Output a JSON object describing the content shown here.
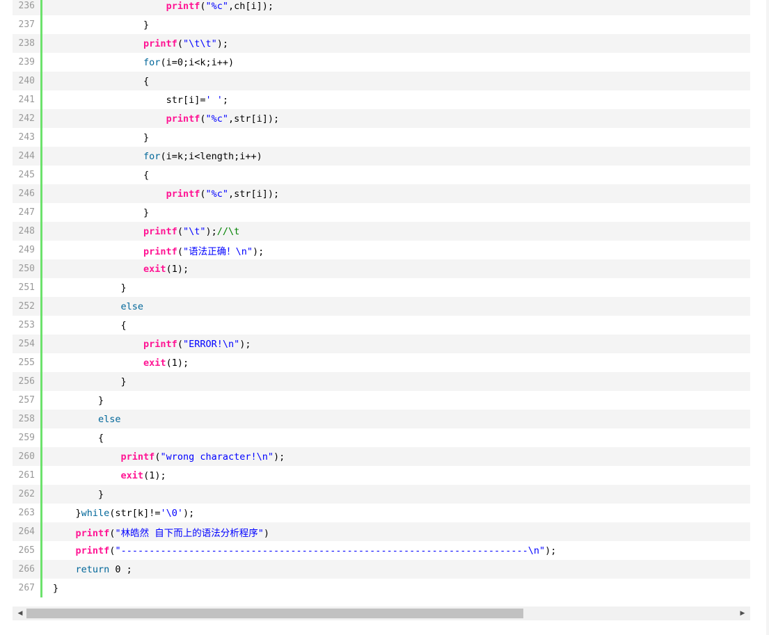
{
  "code": {
    "lines": [
      {
        "n": "236",
        "indent": 5,
        "tokens": [
          {
            "c": "fn",
            "t": "printf"
          },
          {
            "c": "",
            "t": "("
          },
          {
            "c": "str",
            "t": "\"%c\""
          },
          {
            "c": "",
            "t": ",ch[i]);"
          }
        ]
      },
      {
        "n": "237",
        "indent": 4,
        "tokens": [
          {
            "c": "",
            "t": "}"
          }
        ]
      },
      {
        "n": "238",
        "indent": 4,
        "tokens": [
          {
            "c": "fn",
            "t": "printf"
          },
          {
            "c": "",
            "t": "("
          },
          {
            "c": "str",
            "t": "\"\\t\\t\""
          },
          {
            "c": "",
            "t": ");"
          }
        ]
      },
      {
        "n": "239",
        "indent": 4,
        "tokens": [
          {
            "c": "kw",
            "t": "for"
          },
          {
            "c": "",
            "t": "(i=0;i<k;i++)"
          }
        ]
      },
      {
        "n": "240",
        "indent": 4,
        "tokens": [
          {
            "c": "",
            "t": "{"
          }
        ]
      },
      {
        "n": "241",
        "indent": 5,
        "tokens": [
          {
            "c": "",
            "t": "str[i]="
          },
          {
            "c": "str",
            "t": "' '"
          },
          {
            "c": "",
            "t": ";"
          }
        ]
      },
      {
        "n": "242",
        "indent": 5,
        "tokens": [
          {
            "c": "fn",
            "t": "printf"
          },
          {
            "c": "",
            "t": "("
          },
          {
            "c": "str",
            "t": "\"%c\""
          },
          {
            "c": "",
            "t": ",str[i]);"
          }
        ]
      },
      {
        "n": "243",
        "indent": 4,
        "tokens": [
          {
            "c": "",
            "t": "}"
          }
        ]
      },
      {
        "n": "244",
        "indent": 4,
        "tokens": [
          {
            "c": "kw",
            "t": "for"
          },
          {
            "c": "",
            "t": "(i=k;i<length;i++)"
          }
        ]
      },
      {
        "n": "245",
        "indent": 4,
        "tokens": [
          {
            "c": "",
            "t": "{"
          }
        ]
      },
      {
        "n": "246",
        "indent": 5,
        "tokens": [
          {
            "c": "fn",
            "t": "printf"
          },
          {
            "c": "",
            "t": "("
          },
          {
            "c": "str",
            "t": "\"%c\""
          },
          {
            "c": "",
            "t": ",str[i]);"
          }
        ]
      },
      {
        "n": "247",
        "indent": 4,
        "tokens": [
          {
            "c": "",
            "t": "}"
          }
        ]
      },
      {
        "n": "248",
        "indent": 4,
        "tokens": [
          {
            "c": "fn",
            "t": "printf"
          },
          {
            "c": "",
            "t": "("
          },
          {
            "c": "str",
            "t": "\"\\t\""
          },
          {
            "c": "",
            "t": ");"
          },
          {
            "c": "cm",
            "t": "//\\t"
          }
        ]
      },
      {
        "n": "249",
        "indent": 4,
        "tokens": [
          {
            "c": "fn",
            "t": "printf"
          },
          {
            "c": "",
            "t": "("
          },
          {
            "c": "str",
            "t": "\"语法正确！\\n\""
          },
          {
            "c": "",
            "t": ");"
          }
        ]
      },
      {
        "n": "250",
        "indent": 4,
        "tokens": [
          {
            "c": "fn",
            "t": "exit"
          },
          {
            "c": "",
            "t": "(1);"
          }
        ]
      },
      {
        "n": "251",
        "indent": 3,
        "tokens": [
          {
            "c": "",
            "t": "}"
          }
        ]
      },
      {
        "n": "252",
        "indent": 3,
        "tokens": [
          {
            "c": "kw",
            "t": "else"
          }
        ]
      },
      {
        "n": "253",
        "indent": 3,
        "tokens": [
          {
            "c": "",
            "t": "{"
          }
        ]
      },
      {
        "n": "254",
        "indent": 4,
        "tokens": [
          {
            "c": "fn",
            "t": "printf"
          },
          {
            "c": "",
            "t": "("
          },
          {
            "c": "str",
            "t": "\"ERROR!\\n\""
          },
          {
            "c": "",
            "t": ");"
          }
        ]
      },
      {
        "n": "255",
        "indent": 4,
        "tokens": [
          {
            "c": "fn",
            "t": "exit"
          },
          {
            "c": "",
            "t": "(1);"
          }
        ]
      },
      {
        "n": "256",
        "indent": 3,
        "tokens": [
          {
            "c": "",
            "t": "}"
          }
        ]
      },
      {
        "n": "257",
        "indent": 2,
        "tokens": [
          {
            "c": "",
            "t": "}"
          }
        ]
      },
      {
        "n": "258",
        "indent": 2,
        "tokens": [
          {
            "c": "kw",
            "t": "else"
          }
        ]
      },
      {
        "n": "259",
        "indent": 2,
        "tokens": [
          {
            "c": "",
            "t": "{"
          }
        ]
      },
      {
        "n": "260",
        "indent": 3,
        "tokens": [
          {
            "c": "fn",
            "t": "printf"
          },
          {
            "c": "",
            "t": "("
          },
          {
            "c": "str",
            "t": "\"wrong character!\\n\""
          },
          {
            "c": "",
            "t": ");"
          }
        ]
      },
      {
        "n": "261",
        "indent": 3,
        "tokens": [
          {
            "c": "fn",
            "t": "exit"
          },
          {
            "c": "",
            "t": "(1);"
          }
        ]
      },
      {
        "n": "262",
        "indent": 2,
        "tokens": [
          {
            "c": "",
            "t": "}"
          }
        ]
      },
      {
        "n": "263",
        "indent": 1,
        "tokens": [
          {
            "c": "",
            "t": "}"
          },
          {
            "c": "kw",
            "t": "while"
          },
          {
            "c": "",
            "t": "(str[k]!="
          },
          {
            "c": "str",
            "t": "'\\0'"
          },
          {
            "c": "",
            "t": ");"
          }
        ]
      },
      {
        "n": "264",
        "indent": 1,
        "tokens": [
          {
            "c": "fn",
            "t": "printf"
          },
          {
            "c": "",
            "t": "("
          },
          {
            "c": "str",
            "t": "\"林皓然 自下而上的语法分析程序\""
          },
          {
            "c": "",
            "t": ")"
          }
        ]
      },
      {
        "n": "265",
        "indent": 1,
        "tokens": [
          {
            "c": "fn",
            "t": "printf"
          },
          {
            "c": "",
            "t": "("
          },
          {
            "c": "str",
            "t": "\"------------------------------------------------------------------------\\n\""
          },
          {
            "c": "",
            "t": ");"
          }
        ]
      },
      {
        "n": "266",
        "indent": 1,
        "tokens": [
          {
            "c": "kw",
            "t": "return"
          },
          {
            "c": "",
            "t": " 0 ;"
          }
        ]
      },
      {
        "n": "267",
        "indent": 0,
        "tokens": [
          {
            "c": "",
            "t": "}"
          }
        ]
      }
    ]
  },
  "colors": {
    "function": "#ff1493",
    "keyword": "#006699",
    "string": "#0000ff",
    "comment": "#008200",
    "gutter_bar": "#6ce26c",
    "line_number": "#999999"
  },
  "scrollbar": {
    "left_arrow_icon": "◀",
    "right_arrow_icon": "▶",
    "thumb_fraction": 0.7
  }
}
